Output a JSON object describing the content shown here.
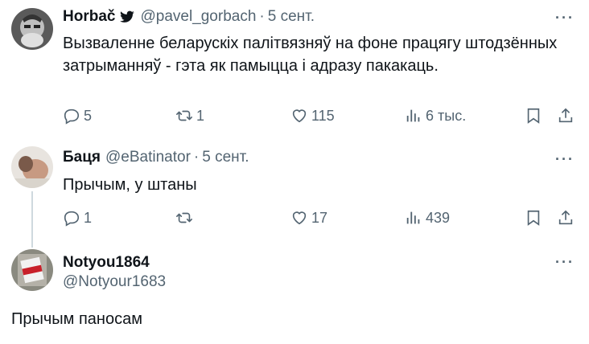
{
  "tweets": [
    {
      "name": "Horbač",
      "handle": "@pavel_gorbach",
      "time": "5 сент.",
      "text": "Вызваленне беларускіх палітвязняў на фоне працягу штодзённых затрыманняў - гэта як памыцца і адразу пакакаць.",
      "replies": "5",
      "retweets": "1",
      "likes": "115",
      "views": "6 тыс."
    },
    {
      "name": "Баця",
      "handle": "@eBatinator",
      "time": "5 сент.",
      "text": "Прычым, у штаны",
      "replies": "1",
      "retweets": "",
      "likes": "17",
      "views": "439"
    },
    {
      "name": "Notyou1864",
      "handle": "@Notyour1683",
      "text": "Прычым паносам"
    }
  ],
  "more_glyph": "···",
  "dot": "·",
  "colors": {
    "text": "#0f1419",
    "secondary": "#536471",
    "line": "#cfd9de"
  }
}
